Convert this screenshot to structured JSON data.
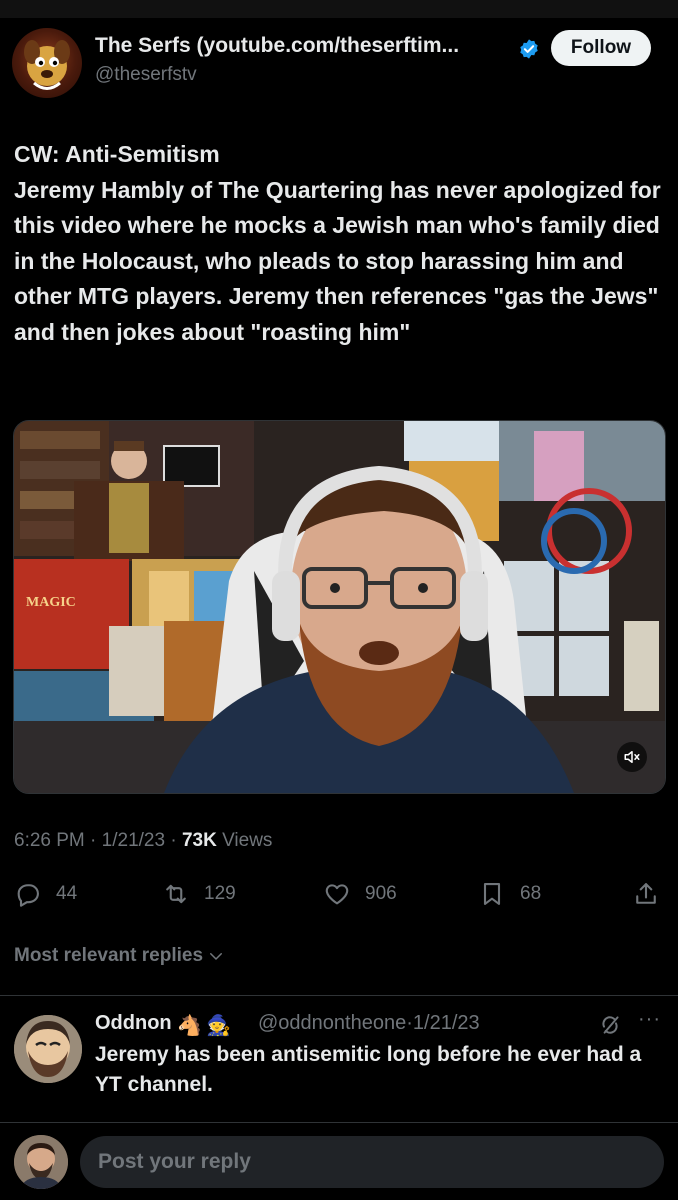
{
  "author": {
    "display_name": "The Serfs (youtube.com/theserftim...",
    "handle": "@theserfstv",
    "verified_color": "#1d9bf0"
  },
  "follow_label": "Follow",
  "tweet": {
    "text": "CW: Anti-Semitism\nJeremy Hambly of The Quartering has never apologized for this video where he mocks a Jewish man who's family died in the Holocaust, who pleads to stop harassing him and other MTG players. Jeremy then references \"gas the Jews\" and then jokes about \"roasting him\""
  },
  "media": {
    "poster_text": "MAGIC",
    "mute_icon": "speaker-muted-icon"
  },
  "meta": {
    "time": "6:26 PM",
    "date": "1/21/23",
    "views_count": "73K",
    "views_label": "Views"
  },
  "actions": {
    "replies": "44",
    "reposts": "129",
    "likes": "906",
    "bookmarks": "68"
  },
  "replies_filter": "Most relevant replies",
  "reply": {
    "name": "Oddnon",
    "emoji1": "🐴",
    "emoji2": "🧙",
    "handle": "@oddnontheone",
    "date": "1/21/23",
    "text": "Jeremy has been antisemitic long before he ever had a YT channel."
  },
  "compose": {
    "placeholder": "Post your reply"
  },
  "colors": {
    "background": "#000000",
    "text": "#e7e9ea",
    "muted": "#71767b",
    "accent": "#1d9bf0"
  }
}
